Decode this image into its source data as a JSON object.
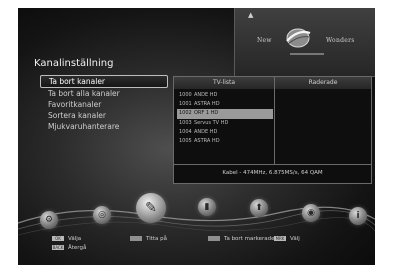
{
  "logo": {
    "left_word": "New",
    "right_word": "Wonders"
  },
  "title": "Kanalinställning",
  "menu": [
    {
      "label": "Ta bort kanaler",
      "selected": true
    },
    {
      "label": "Ta bort alla kanaler",
      "selected": false
    },
    {
      "label": "Favoritkanaler",
      "selected": false
    },
    {
      "label": "Sortera kanaler",
      "selected": false
    },
    {
      "label": "Mjukvaruhanterare",
      "selected": false
    }
  ],
  "channel_list": {
    "col_tv": "TV-lista",
    "col_marked": "Raderade",
    "rows": [
      {
        "num": "1000",
        "name": "ANDE HD",
        "selected": false
      },
      {
        "num": "1001",
        "name": "ASTRA HD",
        "selected": false
      },
      {
        "num": "1002",
        "name": "ORF 1 HD",
        "selected": true
      },
      {
        "num": "1003",
        "name": "Servus TV HD",
        "selected": false
      },
      {
        "num": "1004",
        "name": "ANDE HD",
        "selected": false
      },
      {
        "num": "1005",
        "name": "ASTRA HD",
        "selected": false
      }
    ],
    "info": "Kabel - 474MHz, 6.875MS/s, 64 QAM"
  },
  "bottom_icons": [
    {
      "name": "tools-icon"
    },
    {
      "name": "globe-icon"
    },
    {
      "name": "edit-settings-icon"
    },
    {
      "name": "usb-icon"
    },
    {
      "name": "update-icon"
    },
    {
      "name": "disc-icon"
    },
    {
      "name": "info-icon"
    }
  ],
  "legend": {
    "ok_key": "OK",
    "ok_label": "Välja",
    "green_label": "Titta på",
    "red_label": "Ta bort markerade",
    "mark_key": "MRK",
    "mark_label": "Välj",
    "back_key": "BACK",
    "back_label": "Återgå"
  },
  "colors": {
    "accent": "#9a9a9a",
    "background": "#1a1a1a",
    "text": "#cfcfcf"
  }
}
